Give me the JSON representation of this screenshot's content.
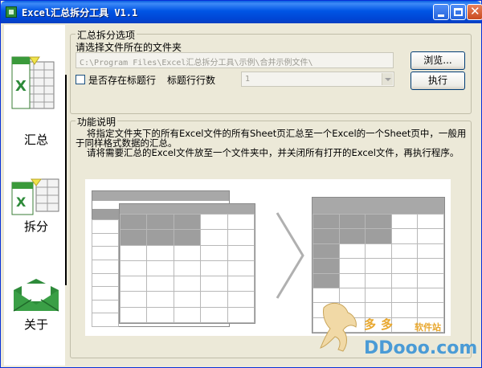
{
  "window": {
    "title": "Excel汇总拆分工具 V1.1"
  },
  "nav": {
    "items": [
      {
        "label": "汇总",
        "icon": "excel-summary-icon"
      },
      {
        "label": "拆分",
        "icon": "excel-split-icon"
      },
      {
        "label": "关于",
        "icon": "envelope-icon"
      }
    ]
  },
  "options": {
    "legend": "汇总拆分选项",
    "folder_label": "请选择文件所在的文件夹",
    "folder_value": "C:\\Program Files\\Excel汇总拆分工具\\示例\\合并示例文件\\",
    "browse_label": "浏览...",
    "run_label": "执行",
    "has_header_label": "是否存在标题行",
    "has_header_checked": false,
    "header_rows_label": "标题行行数",
    "header_rows_value": "1"
  },
  "info": {
    "legend": "功能说明",
    "line1": "将指定文件夹下的所有Excel文件的所有Sheet页汇总至一个Excel的一个Sheet页中，一般用",
    "line2": "于同样格式数据的汇总。",
    "line3": "请将需要汇总的Excel文件放至一个文件夹中，并关闭所有打开的Excel文件，再执行程序。"
  },
  "watermark": {
    "site_name": "多多",
    "site_tag": "软件站",
    "url": "DDooo.com"
  },
  "colors": {
    "titlebar": "#0055E5",
    "face": "#ECE9D8",
    "watermark_orange": "#E8A72E",
    "watermark_blue": "#4A9BD6"
  }
}
